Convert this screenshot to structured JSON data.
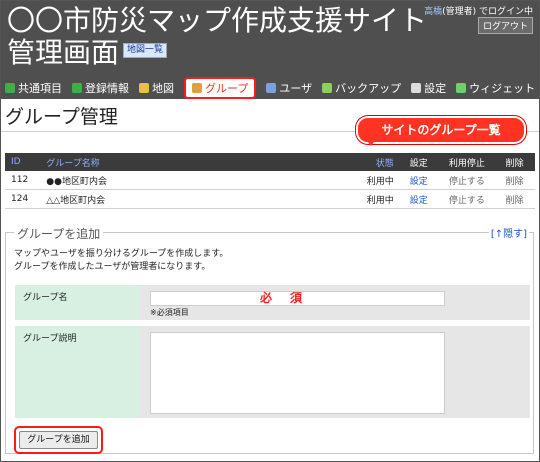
{
  "header": {
    "title_line1": "〇〇市防災マップ作成支援サイト",
    "title_line2": "管理画面",
    "map_list_link": "地図一覧",
    "login_user": "高橋",
    "login_suffix": "(管理者) でログイン中",
    "logout_label": "ログアウト"
  },
  "nav": {
    "items": [
      {
        "label": "共通項目",
        "icon": "leaf-icon",
        "color": "#3fae49"
      },
      {
        "label": "登録情報",
        "icon": "leaf-icon",
        "color": "#3fae49"
      },
      {
        "label": "地図",
        "icon": "map-icon",
        "color": "#e8c240"
      },
      {
        "label": "グループ",
        "icon": "group-icon",
        "color": "#e0a040"
      },
      {
        "label": "ユーザ",
        "icon": "user-icon",
        "color": "#7aa0e0"
      },
      {
        "label": "バックアップ",
        "icon": "backup-icon",
        "color": "#8ccf5a"
      },
      {
        "label": "設定",
        "icon": "gear-icon",
        "color": "#dddddd"
      },
      {
        "label": "ウィジェット",
        "icon": "puzzle-icon",
        "color": "#6fcf6f"
      }
    ],
    "active_index": 3
  },
  "page": {
    "title": "グループ管理",
    "callout": "サイトのグループ一覧"
  },
  "table": {
    "headers": {
      "id": "ID",
      "name": "グループ名称",
      "status": "状態",
      "settings": "設定",
      "suspend": "利用停止",
      "delete": "削除"
    },
    "rows": [
      {
        "id": "112",
        "name": "●●地区町内会",
        "status": "利用中",
        "settings": "設定",
        "suspend": "停止する",
        "delete": "削除"
      },
      {
        "id": "124",
        "name": "△△地区町内会",
        "status": "利用中",
        "settings": "設定",
        "suspend": "停止する",
        "delete": "削除"
      }
    ]
  },
  "add_group": {
    "legend": "グループを追加",
    "hide_link": "[↑隠す]",
    "desc_line1": "マップやユーザを振り分けるグループを作成します。",
    "desc_line2": "グループを作成したユーザが管理者になります。",
    "name_label": "グループ名",
    "required_text": "必須",
    "required_note": "※必須項目",
    "name_value": "",
    "description_label": "グループ説明",
    "description_value": "",
    "submit_label": "グループを追加"
  }
}
